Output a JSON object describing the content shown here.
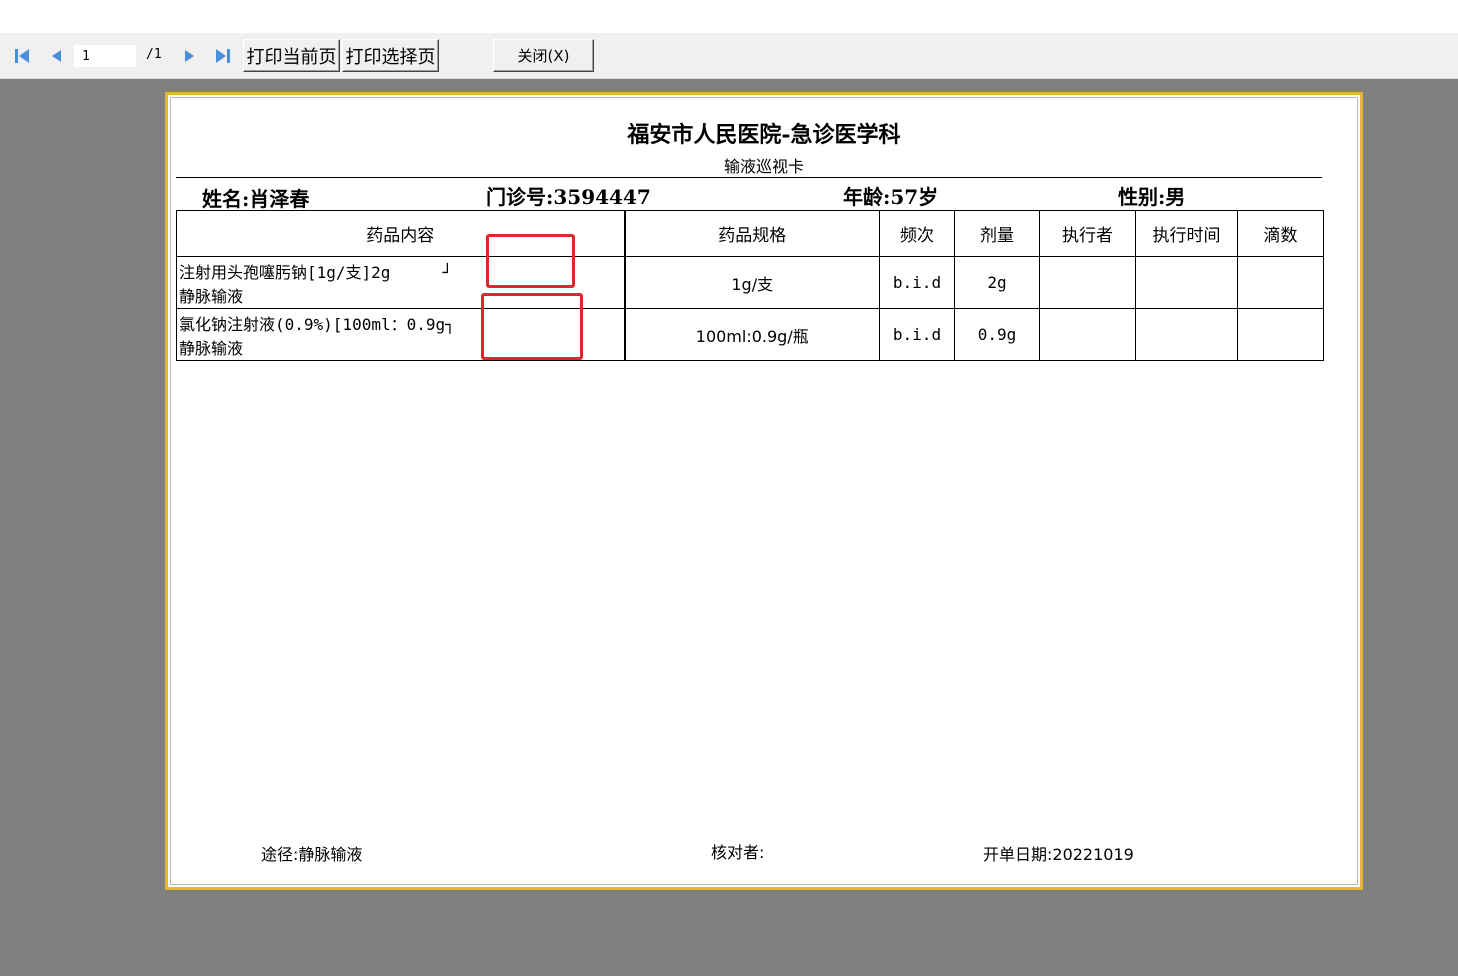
{
  "toolbar": {
    "first_icon": "first-page-icon",
    "prev_icon": "prev-page-icon",
    "next_icon": "next-page-icon",
    "last_icon": "last-page-icon",
    "page_current": "1",
    "page_total": "/1",
    "print_current_label": "打印当前页",
    "print_selected_label": "打印选择页",
    "close_label": "关闭(X)"
  },
  "card": {
    "hospital": "福安市人民医院-急诊医学科",
    "subtitle": "输液巡视卡",
    "patient": {
      "name": "姓名:肖泽春",
      "clinic_no": "门诊号:3594447",
      "age": "年龄:57岁",
      "gender": "性别:男"
    },
    "table": {
      "headers": [
        "药品内容",
        "药品规格",
        "频次",
        "剂量",
        "执行者",
        "执行时间",
        "滴数"
      ],
      "rows": [
        {
          "content_line1": "注射用头孢噻肟钠[1g/支]2g",
          "content_mark": "┘",
          "content_line2": "静脉输液",
          "spec": "1g/支",
          "freq": "b.i.d",
          "dose": "2g",
          "executor": "",
          "exec_time": "",
          "drops": ""
        },
        {
          "content_line1": "氯化钠注射液(0.9%)[100ml：0.9g",
          "content_mark": "┐",
          "content_line2": "静脉输液",
          "spec": "100ml:0.9g/瓶",
          "freq": "b.i.d",
          "dose": "0.9g",
          "executor": "",
          "exec_time": "",
          "drops": ""
        }
      ]
    },
    "footer": {
      "route": "途径:静脉输液",
      "checker": "核对者:",
      "date": "开单日期:20221019"
    }
  },
  "colors": {
    "background": "#808080",
    "toolbar": "#f0f0f0",
    "nav_icon": "#4a90d9",
    "card_border": "#e8b637",
    "annotation": "#e0262b"
  }
}
